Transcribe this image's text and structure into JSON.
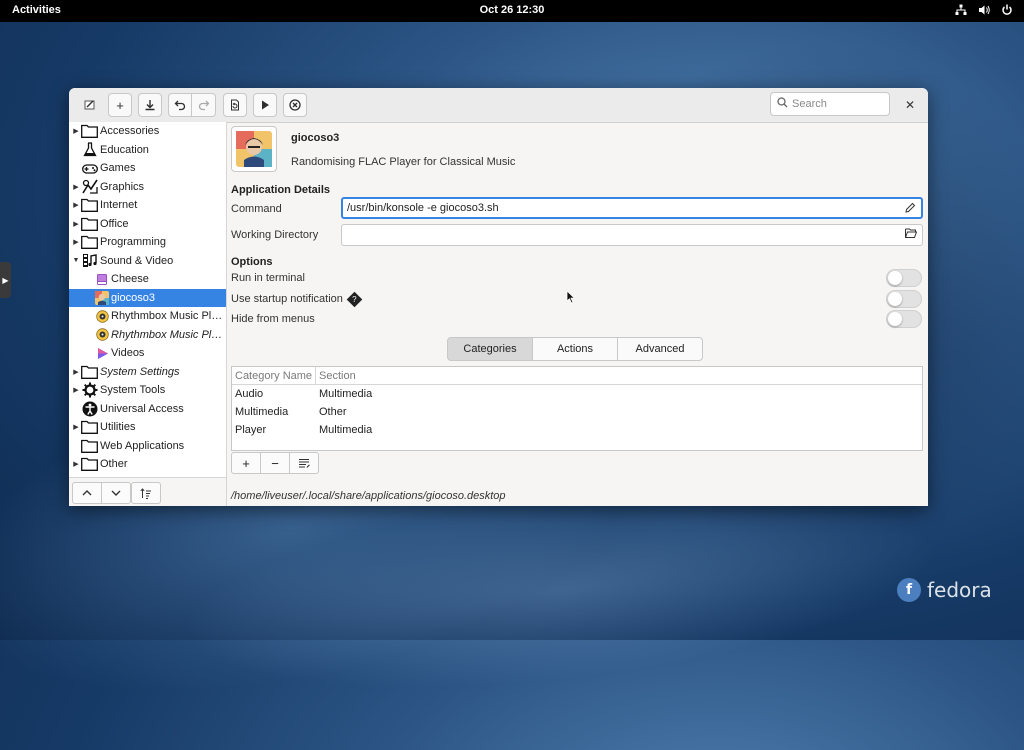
{
  "topbar": {
    "activities": "Activities",
    "datetime": "Oct 26  12:30"
  },
  "window": {
    "search_placeholder": "Search",
    "tree": [
      {
        "label": "Accessories",
        "icon": "folder-icon",
        "expander": "▶",
        "level": 0
      },
      {
        "label": "Education",
        "icon": "flask-icon",
        "expander": "",
        "level": 0
      },
      {
        "label": "Games",
        "icon": "gamepad-icon",
        "expander": "",
        "level": 0
      },
      {
        "label": "Graphics",
        "icon": "graphics-icon",
        "expander": "▶",
        "level": 0
      },
      {
        "label": "Internet",
        "icon": "folder-icon",
        "expander": "▶",
        "level": 0
      },
      {
        "label": "Office",
        "icon": "folder-icon",
        "expander": "▶",
        "level": 0
      },
      {
        "label": "Programming",
        "icon": "folder-icon",
        "expander": "▶",
        "level": 0
      },
      {
        "label": "Sound & Video",
        "icon": "film-icon",
        "expander": "▼",
        "level": 0
      },
      {
        "label": "Cheese",
        "icon": "cheese-icon",
        "expander": "",
        "level": 1
      },
      {
        "label": "giocoso3",
        "icon": "giocoso-icon",
        "expander": "",
        "level": 1,
        "selected": true
      },
      {
        "label": "Rhythmbox Music Pl…",
        "icon": "rhythmbox-icon",
        "expander": "",
        "level": 1
      },
      {
        "label": "Rhythmbox Music Pl…",
        "icon": "rhythmbox-icon",
        "expander": "",
        "level": 1,
        "italic": true
      },
      {
        "label": "Videos",
        "icon": "videos-icon",
        "expander": "",
        "level": 1
      },
      {
        "label": "System Settings",
        "icon": "folder-icon",
        "expander": "▶",
        "level": 0,
        "italic": true
      },
      {
        "label": "System Tools",
        "icon": "gear-icon",
        "expander": "▶",
        "level": 0
      },
      {
        "label": "Universal Access",
        "icon": "accessibility-icon",
        "expander": "",
        "level": 0
      },
      {
        "label": "Utilities",
        "icon": "folder-icon",
        "expander": "▶",
        "level": 0
      },
      {
        "label": "Web Applications",
        "icon": "folder-icon",
        "expander": "",
        "level": 0
      },
      {
        "label": "Other",
        "icon": "folder-icon",
        "expander": "▶",
        "level": 0
      }
    ],
    "app": {
      "name": "giocoso3",
      "description": "Randomising FLAC Player for Classical Music"
    },
    "details": {
      "title": "Application Details",
      "command_label": "Command",
      "command_value": "/usr/bin/konsole -e giocoso3.sh",
      "workdir_label": "Working Directory",
      "workdir_value": ""
    },
    "options": {
      "title": "Options",
      "run_in_terminal": "Run in terminal",
      "startup_notification": "Use startup notification",
      "startup_help": "?",
      "hide_from_menus": "Hide from menus"
    },
    "tabs": [
      "Categories",
      "Actions",
      "Advanced"
    ],
    "categories_table": {
      "headers": [
        "Category Name",
        "Section"
      ],
      "rows": [
        [
          "Audio",
          "Multimedia"
        ],
        [
          "Multimedia",
          "Other"
        ],
        [
          "Player",
          "Multimedia"
        ]
      ]
    },
    "file_path": "/home/liveuser/.local/share/applications/giocoso.desktop"
  },
  "desktop": {
    "logo_text": "fedora"
  }
}
